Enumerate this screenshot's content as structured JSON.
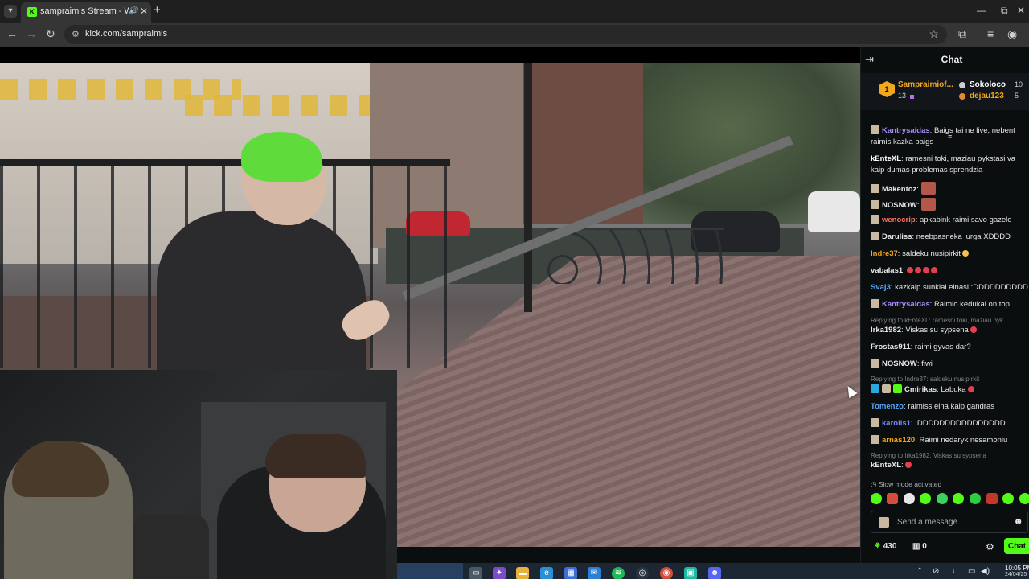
{
  "browser": {
    "tab_list_icon": "chevron-down-icon",
    "tab": {
      "title": "sampraimis Stream - Watch",
      "audio_icon": "speaker-icon",
      "close": "✕"
    },
    "new_tab": "+",
    "window": {
      "minimize": "—",
      "restore": "⧉",
      "close": "✕"
    },
    "toolbar": {
      "back": "←",
      "forward": "→",
      "reload": "↻",
      "url": "kick.com/sampraimis",
      "site_info": "⚙",
      "bookmark": "☆",
      "extensions": "⧉",
      "menu": "⋮"
    }
  },
  "chat": {
    "title": "Chat",
    "pinned": {
      "top_name": "Sampraimiof...",
      "top_count": "13",
      "second_name": "Sokoloco",
      "second_count": "10",
      "third_name": "dejau123",
      "third_count": "5"
    },
    "messages": [
      {
        "user": "Kantrysaidas",
        "color": "#a78bfa",
        "text": ": Baigs tai ne live, nebent raimis kazka baigs",
        "badge": true
      },
      {
        "user": "kEnteXL",
        "color": "#ffffff",
        "text": ": ramesni toki, maziau pykstasi va kaip dumas problemas sprendzia",
        "badge": false
      },
      {
        "user": "Makentoz",
        "color": "#ffffff",
        "text": ": ",
        "badge": true,
        "emote": true
      },
      {
        "user": "NOSNOW",
        "color": "#ffffff",
        "text": ": ",
        "badge": true,
        "emote": true
      },
      {
        "user": "wenocrip",
        "color": "#ff6f61",
        "text": ": apkabink raimi savo gazele",
        "badge": true
      },
      {
        "user": "Daruliss",
        "color": "#ffffff",
        "text": ": neebpasneka jurga XDDDD",
        "badge": true
      },
      {
        "user": "Indre37",
        "color": "#f2a81d",
        "text": ": saldeku nusipirkit",
        "badge": false
      },
      {
        "user": "vabalas1",
        "color": "#ffffff",
        "text": ":",
        "badge": false
      },
      {
        "user": "Svaj3",
        "color": "#5aa9ff",
        "text": ": kazkaip sunkiai einasi :DDDDDDDDDD",
        "badge": false
      },
      {
        "user": "Kantrysaidas",
        "color": "#a78bfa",
        "text": ": Raimio kedukai on top",
        "badge": true
      },
      {
        "user": "Irka1982",
        "color": "#ffffff",
        "text": ": Viskas su sypsena",
        "badge": false,
        "reply": "Replying to kEnteXL: ramesni toki, maziau pyk..."
      },
      {
        "user": "Frostas911",
        "color": "#ffffff",
        "text": ": raimi gyvas dar?",
        "badge": false
      },
      {
        "user": "NOSNOW",
        "color": "#ffffff",
        "text": ": fiwi",
        "badge": true
      },
      {
        "user": "Cmirikas",
        "color": "#ffffff",
        "text": ": Labuka",
        "badge": true,
        "reply": "Replying to Indre37: saldeku nusipirkit"
      },
      {
        "user": "Tomenzo",
        "color": "#5aa9ff",
        "text": ": raimiss eina kaip gandras",
        "badge": false
      },
      {
        "user": "karolis1",
        "color": "#7b83ff",
        "text": ": :DDDDDDDDDDDDDDDD",
        "badge": true
      },
      {
        "user": "arnas120",
        "color": "#f2a81d",
        "text": ": Raimi nedaryk nesamoniu",
        "badge": true
      },
      {
        "user": "kEnteXL",
        "color": "#ffffff",
        "text": ":",
        "badge": false,
        "reply": "Replying to Irka1982: Viskas su sypsena"
      }
    ],
    "slow_mode": "Slow mode activated",
    "composer": {
      "placeholder": "Send a message"
    },
    "footer": {
      "points": "430",
      "store_count": "0",
      "chat_button": "Chat"
    }
  },
  "taskbar": {
    "time": "10:05 PM",
    "date": "24/04/25"
  },
  "colors": {
    "kick_green": "#53fc18",
    "chat_bg": "#0b0e0f"
  }
}
